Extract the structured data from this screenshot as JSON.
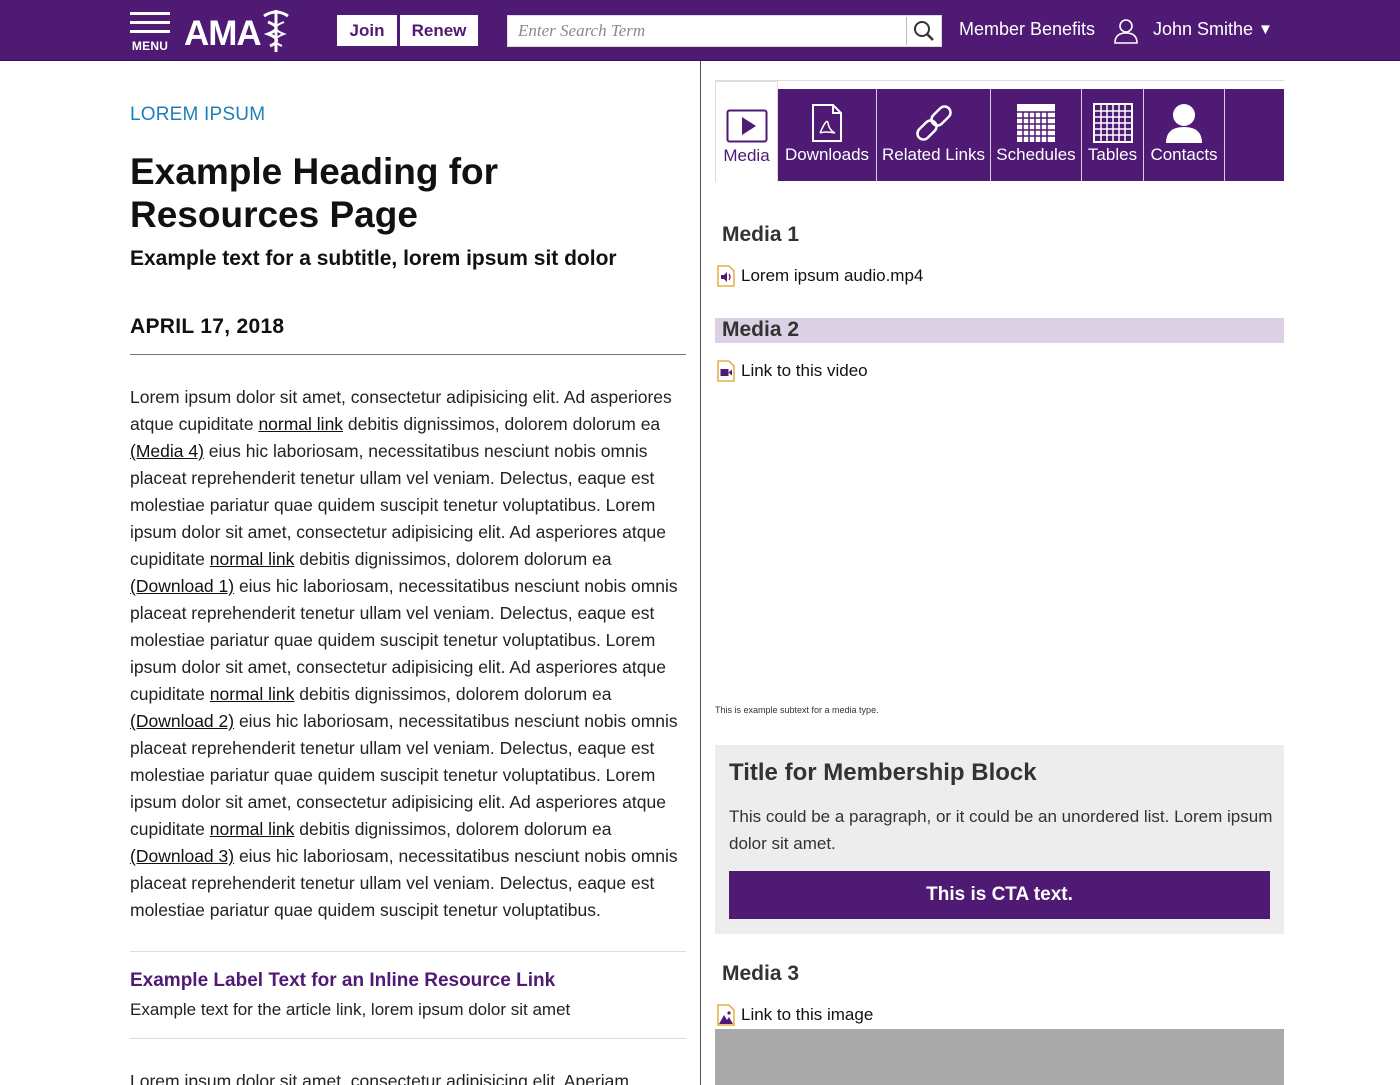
{
  "header": {
    "menu_label": "MENU",
    "logo_text": "AMA",
    "join_label": "Join",
    "renew_label": "Renew",
    "search_placeholder": "Enter Search Term",
    "member_benefits": "Member Benefits",
    "user_name": "John Smithe",
    "user_caret": "▼",
    "brand_color": "#4e1a74"
  },
  "article": {
    "eyebrow": "LOREM IPSUM",
    "title": "Example Heading for Resources Page",
    "subtitle": "Example text for a subtitle, lorem ipsum sit dolor",
    "date": "APRIL 17, 2018",
    "body": {
      "p1": "Lorem ipsum dolor sit amet, consectetur adipisicing elit. Ad asperiores atque cupiditate ",
      "link1": "normal link",
      "p2": " debitis dignissimos, dolorem dolorum ea ",
      "link_media4": "(Media 4)",
      "p3": " eius hic laboriosam, necessitatibus nesciunt nobis omnis placeat reprehenderit tenetur ullam vel veniam. Delectus, eaque est molestiae pariatur quae quidem suscipit tenetur voluptatibus. Lorem ipsum dolor sit amet, consectetur adipisicing elit. Ad asperiores atque cupiditate ",
      "link2": "normal link",
      "p4": " debitis dignissimos, dolorem dolorum ea ",
      "link_download1": "(Download 1)",
      "p5": " eius hic laboriosam, necessitatibus nesciunt nobis omnis placeat reprehenderit tenetur ullam vel veniam. Delectus, eaque est molestiae pariatur quae quidem suscipit tenetur voluptatibus. Lorem ipsum dolor sit amet, consectetur adipisicing elit. Ad asperiores atque cupiditate ",
      "link3": "normal link",
      "p6": " debitis dignissimos, dolorem dolorum ea ",
      "link_download2": "(Download 2)",
      "p7": " eius hic laboriosam, necessitatibus nesciunt nobis omnis placeat reprehenderit tenetur ullam vel veniam. Delectus, eaque est molestiae pariatur quae quidem suscipit tenetur voluptatibus. Lorem ipsum dolor sit amet, consectetur adipisicing elit. Ad asperiores atque cupiditate ",
      "link4": "normal link",
      "p8": " debitis dignissimos, dolorem dolorum ea ",
      "link_download3": "(Download 3)",
      "p9": " eius hic laboriosam, necessitatibus nesciunt nobis omnis placeat reprehenderit tenetur ullam vel veniam. Delectus, eaque est molestiae pariatur quae quidem suscipit tenetur voluptatibus."
    },
    "inline_resource_label": "Example Label Text for an Inline Resource Link",
    "inline_resource_text": "Example text for the article link, lorem ipsum dolor sit amet",
    "body2": "Lorem ipsum dolor sit amet, consectetur adipisicing elit. Aperiam"
  },
  "resources": {
    "tabs": [
      {
        "label": "Media",
        "icon": "play-icon",
        "active": true
      },
      {
        "label": "Downloads",
        "icon": "pdf-icon",
        "active": false
      },
      {
        "label": "Related Links",
        "icon": "link-icon",
        "active": false
      },
      {
        "label": "Schedules",
        "icon": "schedule-grid-icon",
        "active": false
      },
      {
        "label": "Tables",
        "icon": "table-grid-icon",
        "active": false
      },
      {
        "label": "Contacts",
        "icon": "person-icon",
        "active": false
      }
    ],
    "media1": {
      "heading": "Media 1",
      "file": "Lorem ipsum audio.mp4",
      "icon": "audio-file-icon"
    },
    "media2": {
      "heading": "Media 2",
      "file": "Link to this video",
      "icon": "video-file-icon",
      "subtext": "This is example subtext for a media type."
    },
    "membership": {
      "title": "Title for Membership Block",
      "paragraph": "This could be a paragraph, or it could be an unordered list. Lorem ipsum dolor sit amet.",
      "cta": "This is CTA text."
    },
    "media3": {
      "heading": "Media 3",
      "file": "Link to this image",
      "icon": "image-file-icon"
    }
  }
}
